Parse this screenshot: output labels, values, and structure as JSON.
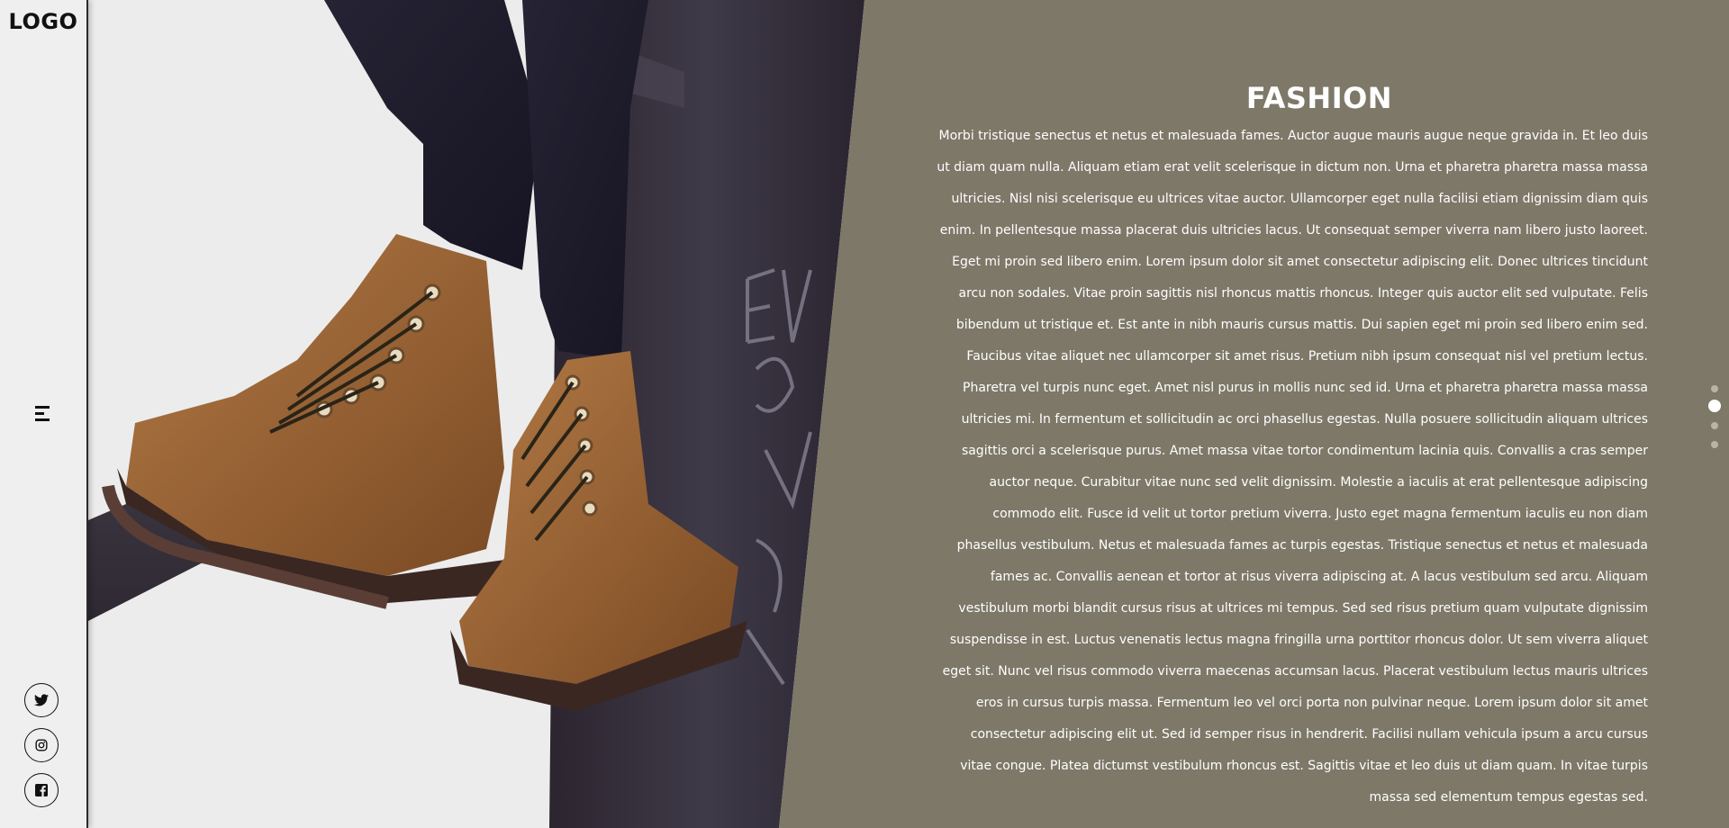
{
  "logo": "LOGO",
  "sidebar": {
    "menu_icon": "menu-icon",
    "social": [
      {
        "name": "twitter-icon"
      },
      {
        "name": "instagram-icon"
      },
      {
        "name": "facebook-icon"
      }
    ]
  },
  "hero": {
    "image_description_icon": "boots-photo"
  },
  "article": {
    "title": "FASHION",
    "body": "Morbi tristique senectus et netus et malesuada fames. Auctor augue mauris augue neque gravida in. Et leo duis ut diam quam nulla. Aliquam etiam erat velit scelerisque in dictum non. Urna et pharetra pharetra massa massa ultricies. Nisl nisi scelerisque eu ultrices vitae auctor. Ullamcorper eget nulla facilisi etiam dignissim diam quis enim. In pellentesque massa placerat duis ultricies lacus. Ut consequat semper viverra nam libero justo laoreet. Eget mi proin sed libero enim. Lorem ipsum dolor sit amet consectetur adipiscing elit. Donec ultrices tincidunt arcu non sodales. Vitae proin sagittis nisl rhoncus mattis rhoncus. Integer quis auctor elit sed vulputate. Felis bibendum ut tristique et. Est ante in nibh mauris cursus mattis. Dui sapien eget mi proin sed libero enim sed. Faucibus vitae aliquet nec ullamcorper sit amet risus. Pretium nibh ipsum consequat nisl vel pretium lectus. Pharetra vel turpis nunc eget. Amet nisl purus in mollis nunc sed id. Urna et pharetra pharetra massa massa ultricies mi. In fermentum et sollicitudin ac orci phasellus egestas. Nulla posuere sollicitudin aliquam ultrices sagittis orci a scelerisque purus. Amet massa vitae tortor condimentum lacinia quis. Convallis a cras semper auctor neque. Curabitur vitae nunc sed velit dignissim. Molestie a iaculis at erat pellentesque adipiscing commodo elit. Fusce id velit ut tortor pretium viverra. Justo eget magna fermentum iaculis eu non diam phasellus vestibulum. Netus et malesuada fames ac turpis egestas. Tristique senectus et netus et malesuada fames ac. Convallis aenean et tortor at risus viverra adipiscing at. A lacus vestibulum sed arcu. Aliquam vestibulum morbi blandit cursus risus at ultrices mi tempus. Sed sed risus pretium quam vulputate dignissim suspendisse in est. Luctus venenatis lectus magna fringilla urna porttitor rhoncus dolor. Ut sem viverra aliquet eget sit. Nunc vel risus commodo viverra maecenas accumsan lacus. Placerat vestibulum lectus mauris ultrices eros in cursus turpis massa. Fermentum leo vel orci porta non pulvinar neque. Lorem ipsum dolor sit amet consectetur adipiscing elit ut. Sed id semper risus in hendrerit. Facilisi nullam vehicula ipsum a arcu cursus vitae congue. Platea dictumst vestibulum rhoncus est. Sagittis vitae et leo duis ut diam quam. In vitae turpis massa sed elementum tempus egestas sed."
  },
  "pagination": {
    "total": 4,
    "active": 2
  },
  "colors": {
    "panel_bg": "#7d7868",
    "sidebar_bg": "#efefef",
    "text": "#ffffff",
    "dot_inactive": "#b8b4a6",
    "dot_active": "#ffffff"
  }
}
